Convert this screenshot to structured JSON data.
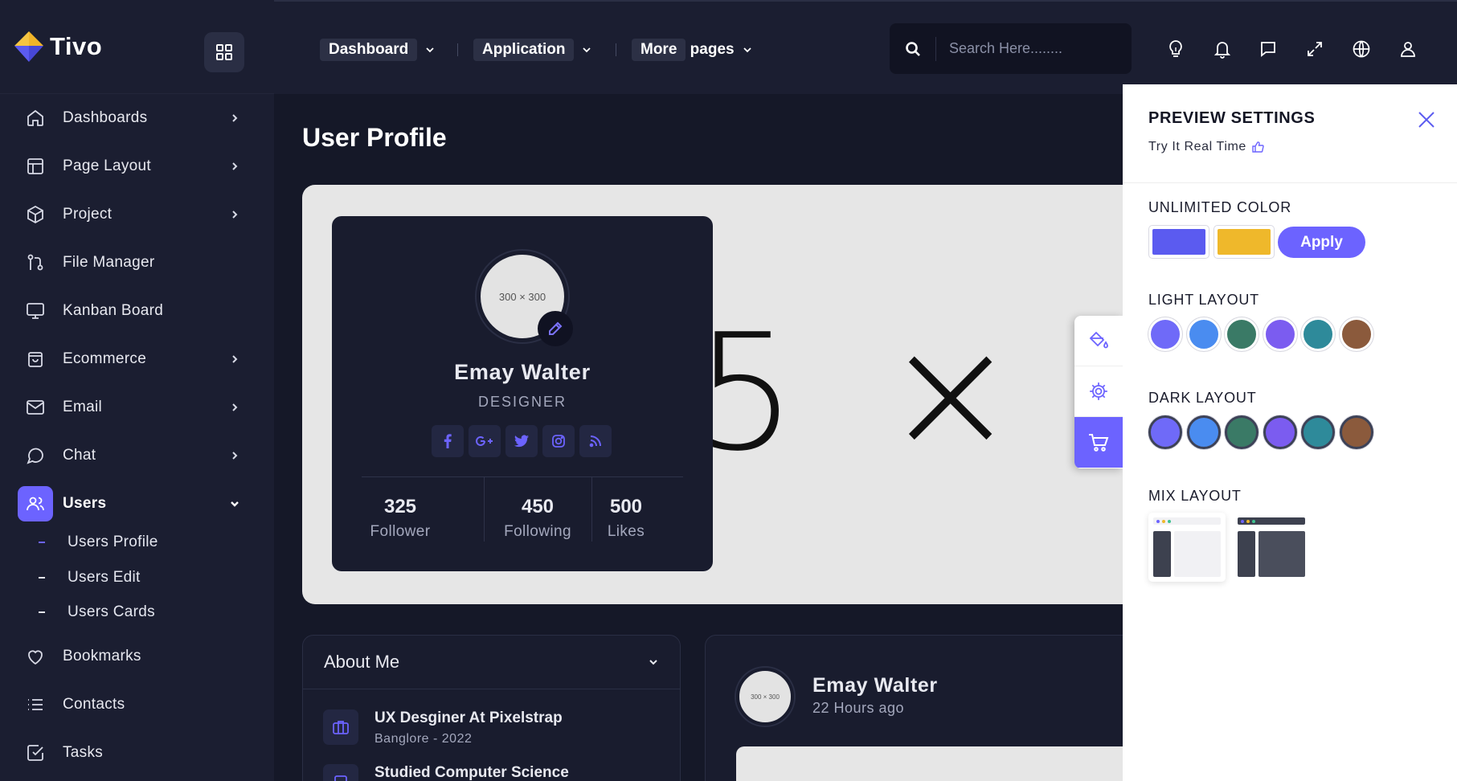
{
  "brand": {
    "name": "Tivo"
  },
  "sidebar": {
    "items": [
      {
        "label": "Dashboards",
        "icon": "home-icon"
      },
      {
        "label": "Page Layout",
        "icon": "layout-icon"
      },
      {
        "label": "Project",
        "icon": "box-icon"
      },
      {
        "label": "File Manager",
        "icon": "git-branch-icon"
      },
      {
        "label": "Kanban Board",
        "icon": "monitor-icon"
      },
      {
        "label": "Ecommerce",
        "icon": "shopping-bag-icon"
      },
      {
        "label": "Email",
        "icon": "mail-icon"
      },
      {
        "label": "Chat",
        "icon": "message-circle-icon"
      },
      {
        "label": "Users",
        "icon": "users-icon"
      },
      {
        "label": "Bookmarks",
        "icon": "heart-icon"
      },
      {
        "label": "Contacts",
        "icon": "list-icon"
      },
      {
        "label": "Tasks",
        "icon": "check-square-icon"
      }
    ],
    "sub_items": [
      "Users Profile",
      "Users Edit",
      "Users Cards"
    ]
  },
  "header": {
    "nav": [
      {
        "highlight": "Dashboard",
        "rest": ""
      },
      {
        "highlight": "Application",
        "rest": ""
      },
      {
        "highlight": "More",
        "rest": " pages"
      }
    ],
    "search_placeholder": "Search Here........"
  },
  "main": {
    "page_title": "User Profile",
    "cover_placeholder": "5 × 4",
    "profile": {
      "avatar_placeholder": "300 × 300",
      "name": "Emay Walter",
      "role": "DESIGNER",
      "stats": [
        {
          "value": "325",
          "label": "Follower"
        },
        {
          "value": "450",
          "label": "Following"
        },
        {
          "value": "500",
          "label": "Likes"
        }
      ]
    },
    "about": {
      "title": "About Me",
      "items": [
        {
          "title": "UX Desginer At Pixelstrap",
          "sub": "Banglore - 2022"
        },
        {
          "title": "Studied Computer Science",
          "sub": ""
        }
      ]
    },
    "post": {
      "avatar_placeholder": "300 × 300",
      "name": "Emay Walter",
      "time": "22 Hours ago"
    }
  },
  "settings": {
    "title": "PREVIEW SETTINGS",
    "subtitle": "Try It Real Time",
    "unlimited_color": "UNLIMITED COLOR",
    "apply_label": "Apply",
    "swatches": [
      "#5b5bf0",
      "#efb82b"
    ],
    "light_layout": "LIGHT LAYOUT",
    "dark_layout": "DARK LAYOUT",
    "mix_layout": "MIX LAYOUT",
    "layout_colors": [
      "#6f6af8",
      "#4a8cf0",
      "#3a7a66",
      "#7b5cf0",
      "#2e8a9a",
      "#8b5a3c"
    ]
  },
  "colors": {
    "accent": "#6c63ff",
    "sidebar_bg": "#1b1e31",
    "page_bg": "#151828"
  }
}
